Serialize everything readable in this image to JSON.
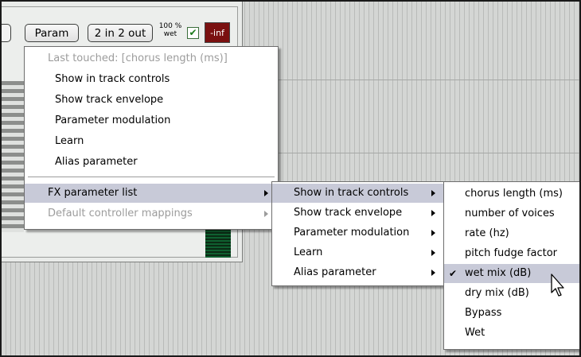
{
  "toolbar": {
    "param_label": "Param",
    "io_label": "2 in 2 out",
    "wet_pct": "100 %",
    "wet_label": "wet",
    "wet_checked_glyph": "✔",
    "level_label": "-inf"
  },
  "context_menu": {
    "header": "Last touched: [chorus length (ms)]",
    "items": [
      {
        "label": "Show in track controls"
      },
      {
        "label": "Show track envelope"
      },
      {
        "label": "Parameter modulation"
      },
      {
        "label": "Learn"
      },
      {
        "label": "Alias parameter"
      }
    ],
    "fx_parameter_list": "FX parameter list",
    "default_controller_mappings": "Default controller mappings"
  },
  "submenu": {
    "items": [
      {
        "label": "Show in track controls"
      },
      {
        "label": "Show track envelope"
      },
      {
        "label": "Parameter modulation"
      },
      {
        "label": "Learn"
      },
      {
        "label": "Alias parameter"
      }
    ]
  },
  "param_menu": {
    "items": [
      {
        "label": "chorus length (ms)",
        "checked": false
      },
      {
        "label": "number of voices",
        "checked": false
      },
      {
        "label": "rate (hz)",
        "checked": false
      },
      {
        "label": "pitch fudge factor",
        "checked": false
      },
      {
        "label": "wet mix (dB)",
        "checked": true
      },
      {
        "label": "dry mix (dB)",
        "checked": false
      },
      {
        "label": "Bypass",
        "checked": false
      },
      {
        "label": "Wet",
        "checked": false
      }
    ],
    "check_glyph": "✔"
  },
  "colors": {
    "highlight": "#c8cad8",
    "disabled_text": "#9c9c9c",
    "level_bg": "#7a1010"
  },
  "icons": {
    "cursor": "arrow-pointer-icon",
    "submenu_arrow": "triangle-right-icon"
  }
}
